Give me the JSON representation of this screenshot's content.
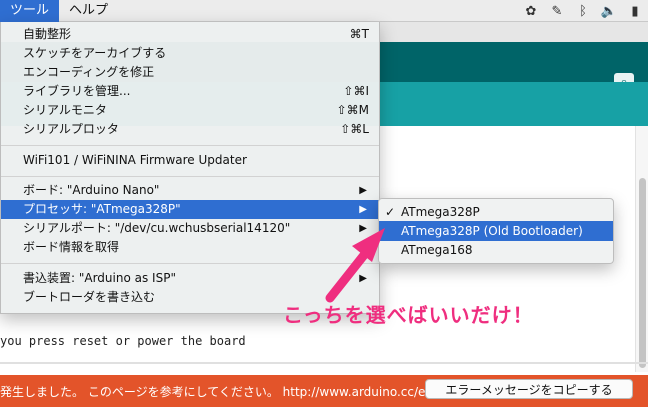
{
  "menubar": {
    "tools": "ツール",
    "help": "ヘルプ"
  },
  "tools_menu": {
    "items": [
      {
        "label": "自動整形",
        "shortcut": "⌘T"
      },
      {
        "label": "スケッチをアーカイブする",
        "shortcut": ""
      },
      {
        "label": "エンコーディングを修正",
        "shortcut": ""
      },
      {
        "label": "ライブラリを管理...",
        "shortcut": "⇧⌘I"
      },
      {
        "label": "シリアルモニタ",
        "shortcut": "⇧⌘M"
      },
      {
        "label": "シリアルプロッタ",
        "shortcut": "⇧⌘L"
      },
      {
        "label": "WiFi101 / WiFiNINA Firmware Updater",
        "shortcut": ""
      },
      {
        "label": "ボード: \"Arduino Nano\"",
        "shortcut": ""
      },
      {
        "label": "プロセッサ: \"ATmega328P\"",
        "shortcut": ""
      },
      {
        "label": "シリアルポート: \"/dev/cu.wchusbserial14120\"",
        "shortcut": ""
      },
      {
        "label": "ボード情報を取得",
        "shortcut": ""
      },
      {
        "label": "書込装置: \"Arduino as ISP\"",
        "shortcut": ""
      },
      {
        "label": "ブートローダを書き込む",
        "shortcut": ""
      }
    ]
  },
  "processor_menu": {
    "items": [
      {
        "label": "ATmega328P",
        "checked": true
      },
      {
        "label": "ATmega328P (Old Bootloader)",
        "checked": false
      },
      {
        "label": "ATmega168",
        "checked": false
      }
    ],
    "check_mark": "✓"
  },
  "console": {
    "line": "you press reset or power the board"
  },
  "error_bar": {
    "text": "発生しました。 このページを参考にしてください。 http://www.arduino.cc/en",
    "copy_button": "エラーメッセージをコピーする"
  },
  "annotation": {
    "text": "こっちを選べばいいだけ！",
    "color": "#ef2e7f"
  },
  "colors": {
    "accent": "#2f6ed1",
    "toolbar": "#006468",
    "tabs": "#17a1a5",
    "error": "#e3542a"
  }
}
